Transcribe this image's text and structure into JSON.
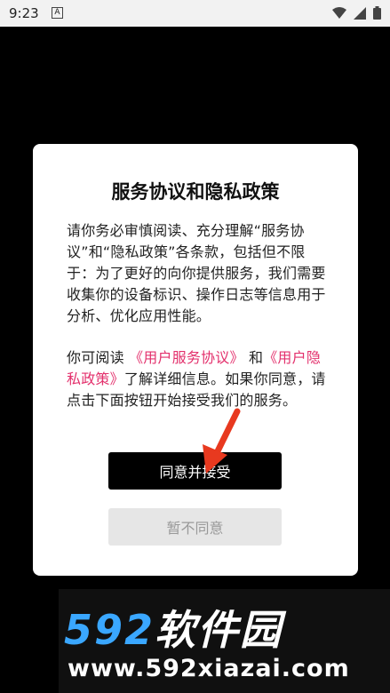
{
  "status_bar": {
    "time": "9:23",
    "notification_badge": "A"
  },
  "dialog": {
    "title": "服务协议和隐私政策",
    "para1": "请你务必审慎阅读、充分理解“服务协议”和“隐私政策”各条款，包括但不限于：为了更好的向你提供服务，我们需要收集你的设备标识、操作日志等信息用于分析、优化应用性能。",
    "para2_prefix": "你可阅读",
    "link_user_agreement": "《用户服务协议》",
    "para2_and": "和",
    "link_privacy_policy": "《用户隐私政策》",
    "para2_suffix": "了解详细信息。如果你同意，请点击下面按钮开始接受我们的服务。",
    "accept_button": "同意并接受",
    "decline_button": "暂不同意"
  },
  "watermark": {
    "logo_number": "592",
    "logo_text": "软件园",
    "url": "www.592xiazai.com"
  },
  "colors": {
    "link": "#e3306c",
    "accept_bg": "#000000",
    "arrow": "#e8391f",
    "watermark_blue": "#3aa7ff"
  },
  "icons": [
    "wifi-icon",
    "signal-icon",
    "battery-icon",
    "arrow-annotation-icon"
  ]
}
